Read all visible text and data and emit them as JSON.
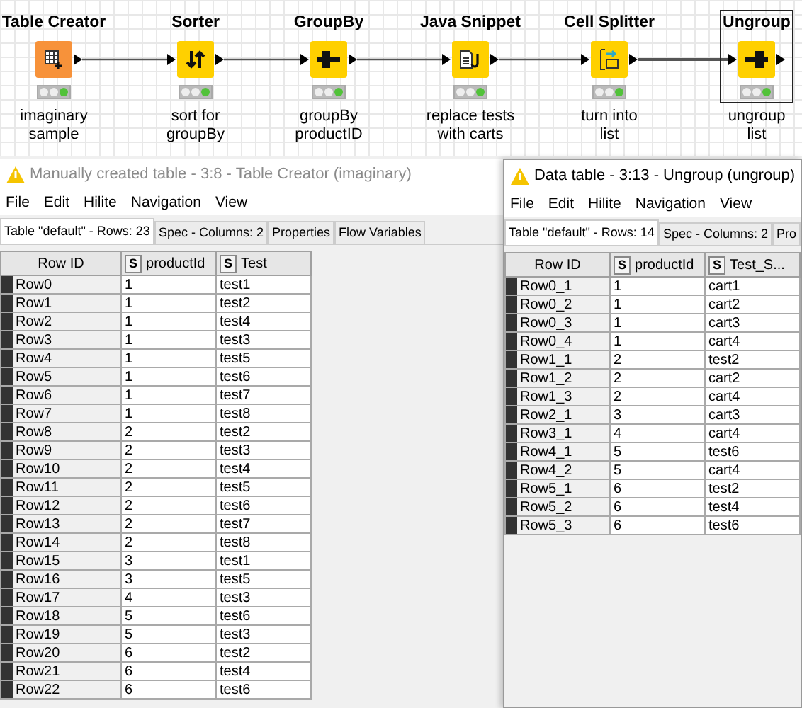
{
  "workflow": {
    "nodes": [
      {
        "name": "Table Creator",
        "kind": "table-creator",
        "color": "#f7923a",
        "description": [
          "imaginary",
          "sample"
        ],
        "selected": false
      },
      {
        "name": "Sorter",
        "kind": "sorter",
        "color": "#ffd000",
        "description": [
          "sort for",
          "groupBy"
        ],
        "selected": false
      },
      {
        "name": "GroupBy",
        "kind": "groupby",
        "color": "#ffd000",
        "description": [
          "groupBy",
          "productID"
        ],
        "selected": false
      },
      {
        "name": "Java Snippet",
        "kind": "java-snippet",
        "color": "#ffd000",
        "description": [
          "replace tests",
          "with carts"
        ],
        "selected": false
      },
      {
        "name": "Cell Splitter",
        "kind": "cell-splitter",
        "color": "#ffd000",
        "description": [
          "turn into",
          "list"
        ],
        "selected": false
      },
      {
        "name": "Ungroup",
        "kind": "ungroup",
        "color": "#ffd000",
        "description": [
          "ungroup",
          "list"
        ],
        "selected": true
      }
    ]
  },
  "windows": [
    {
      "title": "Manually created table - 3:8 - Table Creator (imaginary)",
      "title_disabled": true,
      "menu": [
        "File",
        "Edit",
        "Hilite",
        "Navigation",
        "View"
      ],
      "tabs": [
        {
          "label": "Table \"default\" - Rows: 23",
          "selected": true
        },
        {
          "label": "Spec - Columns: 2",
          "selected": false
        },
        {
          "label": "Properties",
          "selected": false
        },
        {
          "label": "Flow Variables",
          "selected": false
        }
      ],
      "columns": [
        {
          "label": "Row ID"
        },
        {
          "label": "productId",
          "type": "S"
        },
        {
          "label": "Test",
          "type": "S"
        }
      ],
      "rows": [
        [
          "Row0",
          "1",
          "test1"
        ],
        [
          "Row1",
          "1",
          "test2"
        ],
        [
          "Row2",
          "1",
          "test4"
        ],
        [
          "Row3",
          "1",
          "test3"
        ],
        [
          "Row4",
          "1",
          "test5"
        ],
        [
          "Row5",
          "1",
          "test6"
        ],
        [
          "Row6",
          "1",
          "test7"
        ],
        [
          "Row7",
          "1",
          "test8"
        ],
        [
          "Row8",
          "2",
          "test2"
        ],
        [
          "Row9",
          "2",
          "test3"
        ],
        [
          "Row10",
          "2",
          "test4"
        ],
        [
          "Row11",
          "2",
          "test5"
        ],
        [
          "Row12",
          "2",
          "test6"
        ],
        [
          "Row13",
          "2",
          "test7"
        ],
        [
          "Row14",
          "2",
          "test8"
        ],
        [
          "Row15",
          "3",
          "test1"
        ],
        [
          "Row16",
          "3",
          "test5"
        ],
        [
          "Row17",
          "4",
          "test3"
        ],
        [
          "Row18",
          "5",
          "test6"
        ],
        [
          "Row19",
          "5",
          "test3"
        ],
        [
          "Row20",
          "6",
          "test2"
        ],
        [
          "Row21",
          "6",
          "test4"
        ],
        [
          "Row22",
          "6",
          "test6"
        ]
      ]
    },
    {
      "title": "Data table - 3:13 - Ungroup (ungroup)",
      "title_disabled": false,
      "menu": [
        "File",
        "Edit",
        "Hilite",
        "Navigation",
        "View"
      ],
      "tabs": [
        {
          "label": "Table \"default\" - Rows: 14",
          "selected": true
        },
        {
          "label": "Spec - Columns: 2",
          "selected": false
        },
        {
          "label": "Pro",
          "selected": false
        }
      ],
      "columns": [
        {
          "label": "Row ID"
        },
        {
          "label": "productId",
          "type": "S"
        },
        {
          "label": "Test_S...",
          "type": "S"
        }
      ],
      "rows": [
        [
          "Row0_1",
          "1",
          "cart1"
        ],
        [
          "Row0_2",
          "1",
          "cart2"
        ],
        [
          "Row0_3",
          "1",
          "cart3"
        ],
        [
          "Row0_4",
          "1",
          "cart4"
        ],
        [
          "Row1_1",
          "2",
          "test2"
        ],
        [
          "Row1_2",
          "2",
          "cart2"
        ],
        [
          "Row1_3",
          "2",
          "cart4"
        ],
        [
          "Row2_1",
          "3",
          "cart3"
        ],
        [
          "Row3_1",
          "4",
          "cart4"
        ],
        [
          "Row4_1",
          "5",
          "test6"
        ],
        [
          "Row4_2",
          "5",
          "cart4"
        ],
        [
          "Row5_1",
          "6",
          "test2"
        ],
        [
          "Row5_2",
          "6",
          "test4"
        ],
        [
          "Row5_3",
          "6",
          "test6"
        ]
      ]
    }
  ]
}
